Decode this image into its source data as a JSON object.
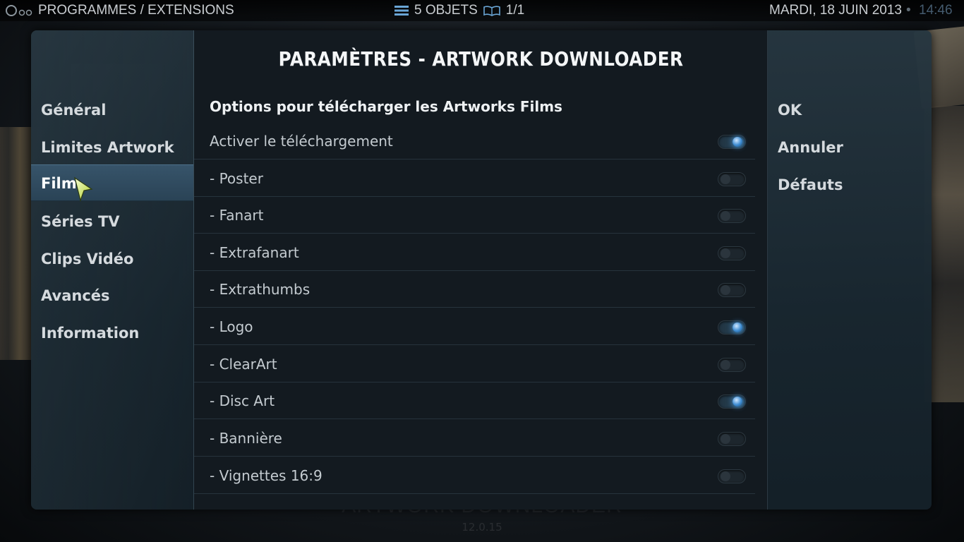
{
  "topbar": {
    "breadcrumb": "PROGRAMMES / EXTENSIONS",
    "items_count": "5 OBJETS",
    "page": "1/1",
    "date": "MARDI, 18 JUIN 2013",
    "separator": "•",
    "time": "14:46"
  },
  "background": {
    "addon_title": "ARTWORK DOWNLOADER",
    "addon_version": "12.0.15"
  },
  "dialog": {
    "title": "PARAMÈTRES - ARTWORK DOWNLOADER",
    "categories": [
      {
        "label": "Général",
        "active": false
      },
      {
        "label": "Limites Artwork",
        "active": false
      },
      {
        "label": "Film",
        "active": true
      },
      {
        "label": "Séries TV",
        "active": false
      },
      {
        "label": "Clips Vidéo",
        "active": false
      },
      {
        "label": "Avancés",
        "active": false
      },
      {
        "label": "Information",
        "active": false
      }
    ],
    "section_header": "Options pour télécharger les Artworks Films",
    "settings": [
      {
        "label": "Activer le téléchargement",
        "enabled": true
      },
      {
        "label": "- Poster",
        "enabled": false
      },
      {
        "label": "- Fanart",
        "enabled": false
      },
      {
        "label": "- Extrafanart",
        "enabled": false
      },
      {
        "label": "- Extrathumbs",
        "enabled": false
      },
      {
        "label": "- Logo",
        "enabled": true
      },
      {
        "label": "- ClearArt",
        "enabled": false
      },
      {
        "label": "- Disc Art",
        "enabled": true
      },
      {
        "label": "- Bannière",
        "enabled": false
      },
      {
        "label": "- Vignettes 16:9",
        "enabled": false
      }
    ],
    "buttons": {
      "ok": "OK",
      "cancel": "Annuler",
      "defaults": "Défauts"
    }
  },
  "colors": {
    "accent": "#3d8bd1",
    "active_category": "#2f4b60"
  }
}
